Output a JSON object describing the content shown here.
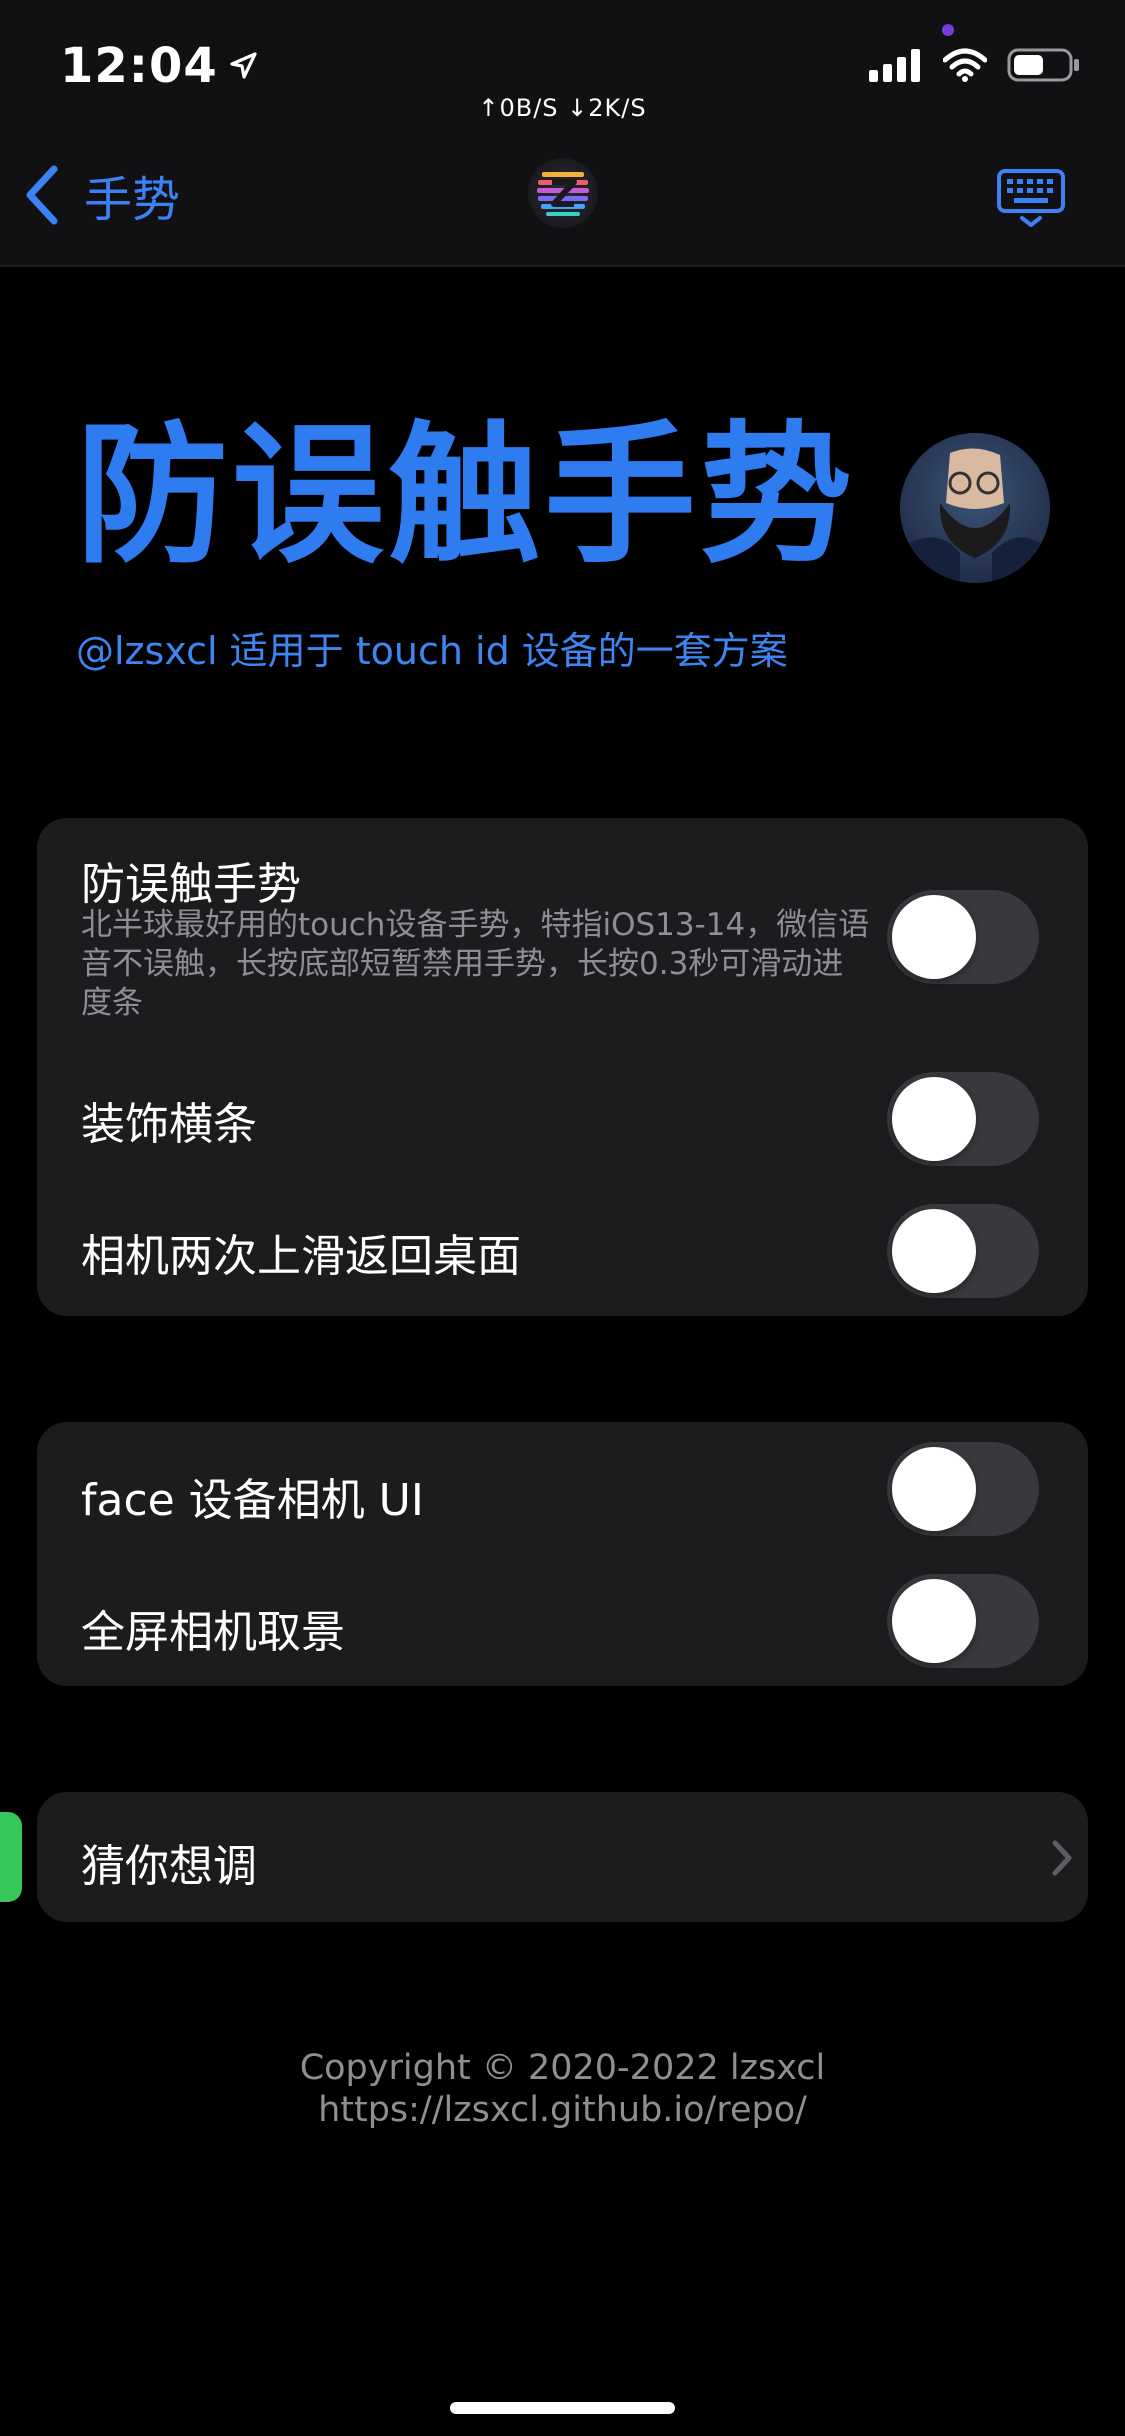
{
  "status_bar": {
    "time": "12:04",
    "net_speed": "↑0B/S ↓2K/S",
    "battery_level": 0.55
  },
  "nav": {
    "back_label": "手势"
  },
  "hero": {
    "title": "防误触手势",
    "subtitle": "@lzsxcl 适用于 touch id 设备的一套方案"
  },
  "group1": {
    "items": [
      {
        "title": "防误触手势",
        "description": "北半球最好用的touch设备手势，特指iOS13-14，微信语音不误触，长按底部短暂禁用手势，长按0.3秒可滑动进度条",
        "enabled": false
      },
      {
        "title": "装饰横条",
        "enabled": false
      },
      {
        "title": "相机两次上滑返回桌面",
        "enabled": false
      }
    ]
  },
  "group2": {
    "items": [
      {
        "title": "face 设备相机 UI",
        "enabled": false
      },
      {
        "title": "全屏相机取景",
        "enabled": false
      }
    ]
  },
  "group3": {
    "items": [
      {
        "title": "猜你想调"
      }
    ]
  },
  "footer": {
    "copyright": "Copyright © 2020-2022 lzsxcl",
    "url": "https://lzsxcl.github.io/repo/"
  },
  "colors": {
    "accent": "#2f7bf0",
    "background": "#000000",
    "cell_background": "#1c1c1e",
    "toggle_off": "#39393d",
    "secondary_text": "#8e8e93"
  }
}
